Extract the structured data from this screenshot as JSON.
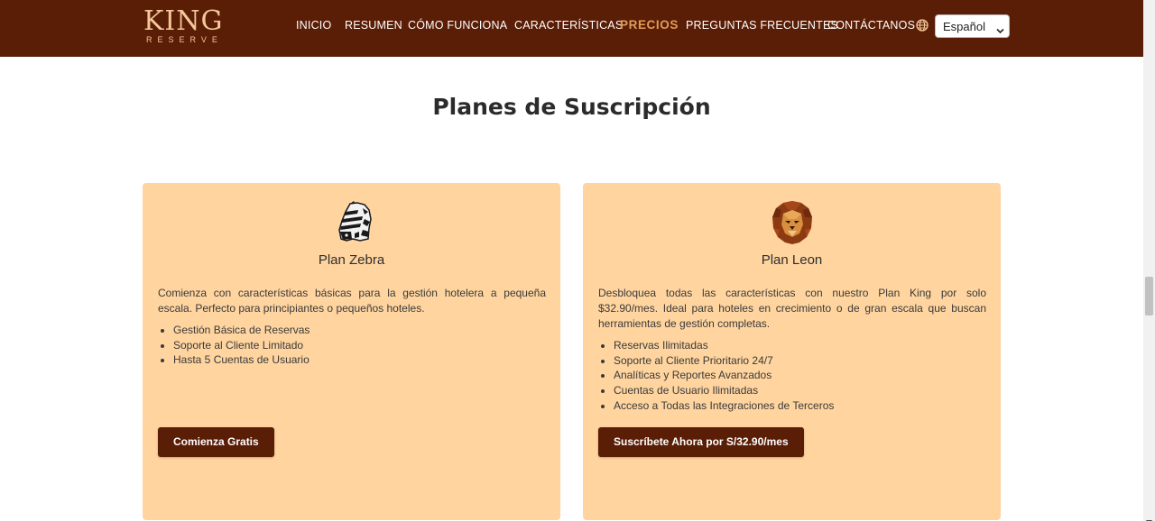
{
  "header": {
    "logo": {
      "main": "KING",
      "sub": "RESERVE"
    },
    "nav": [
      {
        "label": "INICIO",
        "active": false
      },
      {
        "label": "RESUMEN",
        "active": false
      },
      {
        "label": "CÓMO FUNCIONA",
        "active": false
      },
      {
        "label": "CARACTERÍSTICAS",
        "active": false
      },
      {
        "label": "PRECIOS",
        "active": true
      },
      {
        "label": "PREGUNTAS FRECUENTES",
        "active": false
      },
      {
        "label": "CONTÁCTANOS",
        "active": false
      }
    ],
    "language": {
      "icon": "globe-icon",
      "selected": "Español"
    }
  },
  "section": {
    "title": "Planes de Suscripción"
  },
  "plans": [
    {
      "icon": "zebra-icon",
      "name": "Plan Zebra",
      "description": "Comienza con características básicas para la gestión hotelera a pequeña escala. Perfecto para principiantes o pequeños hoteles.",
      "features": [
        "Gestión Básica de Reservas",
        "Soporte al Cliente Limitado",
        "Hasta 5 Cuentas de Usuario"
      ],
      "cta": "Comienza Gratis"
    },
    {
      "icon": "lion-icon",
      "name": "Plan Leon",
      "description": "Desbloquea todas las características con nuestro Plan King por solo $32.90/mes. Ideal para hoteles en crecimiento o de gran escala que buscan herramientas de gestión completas.",
      "features": [
        "Reservas Ilimitadas",
        "Soporte al Cliente Prioritario 24/7",
        "Analíticas y Reportes Avanzados",
        "Cuentas de Usuario Ilimitadas",
        "Acceso a Todas las Integraciones de Terceros"
      ],
      "cta": "Suscríbete Ahora por S/32.90/mes"
    }
  ],
  "colors": {
    "navbar": "#5a1d05",
    "accent": "#e19b5b",
    "card": "#ffd49f",
    "button": "#5a1d05"
  }
}
